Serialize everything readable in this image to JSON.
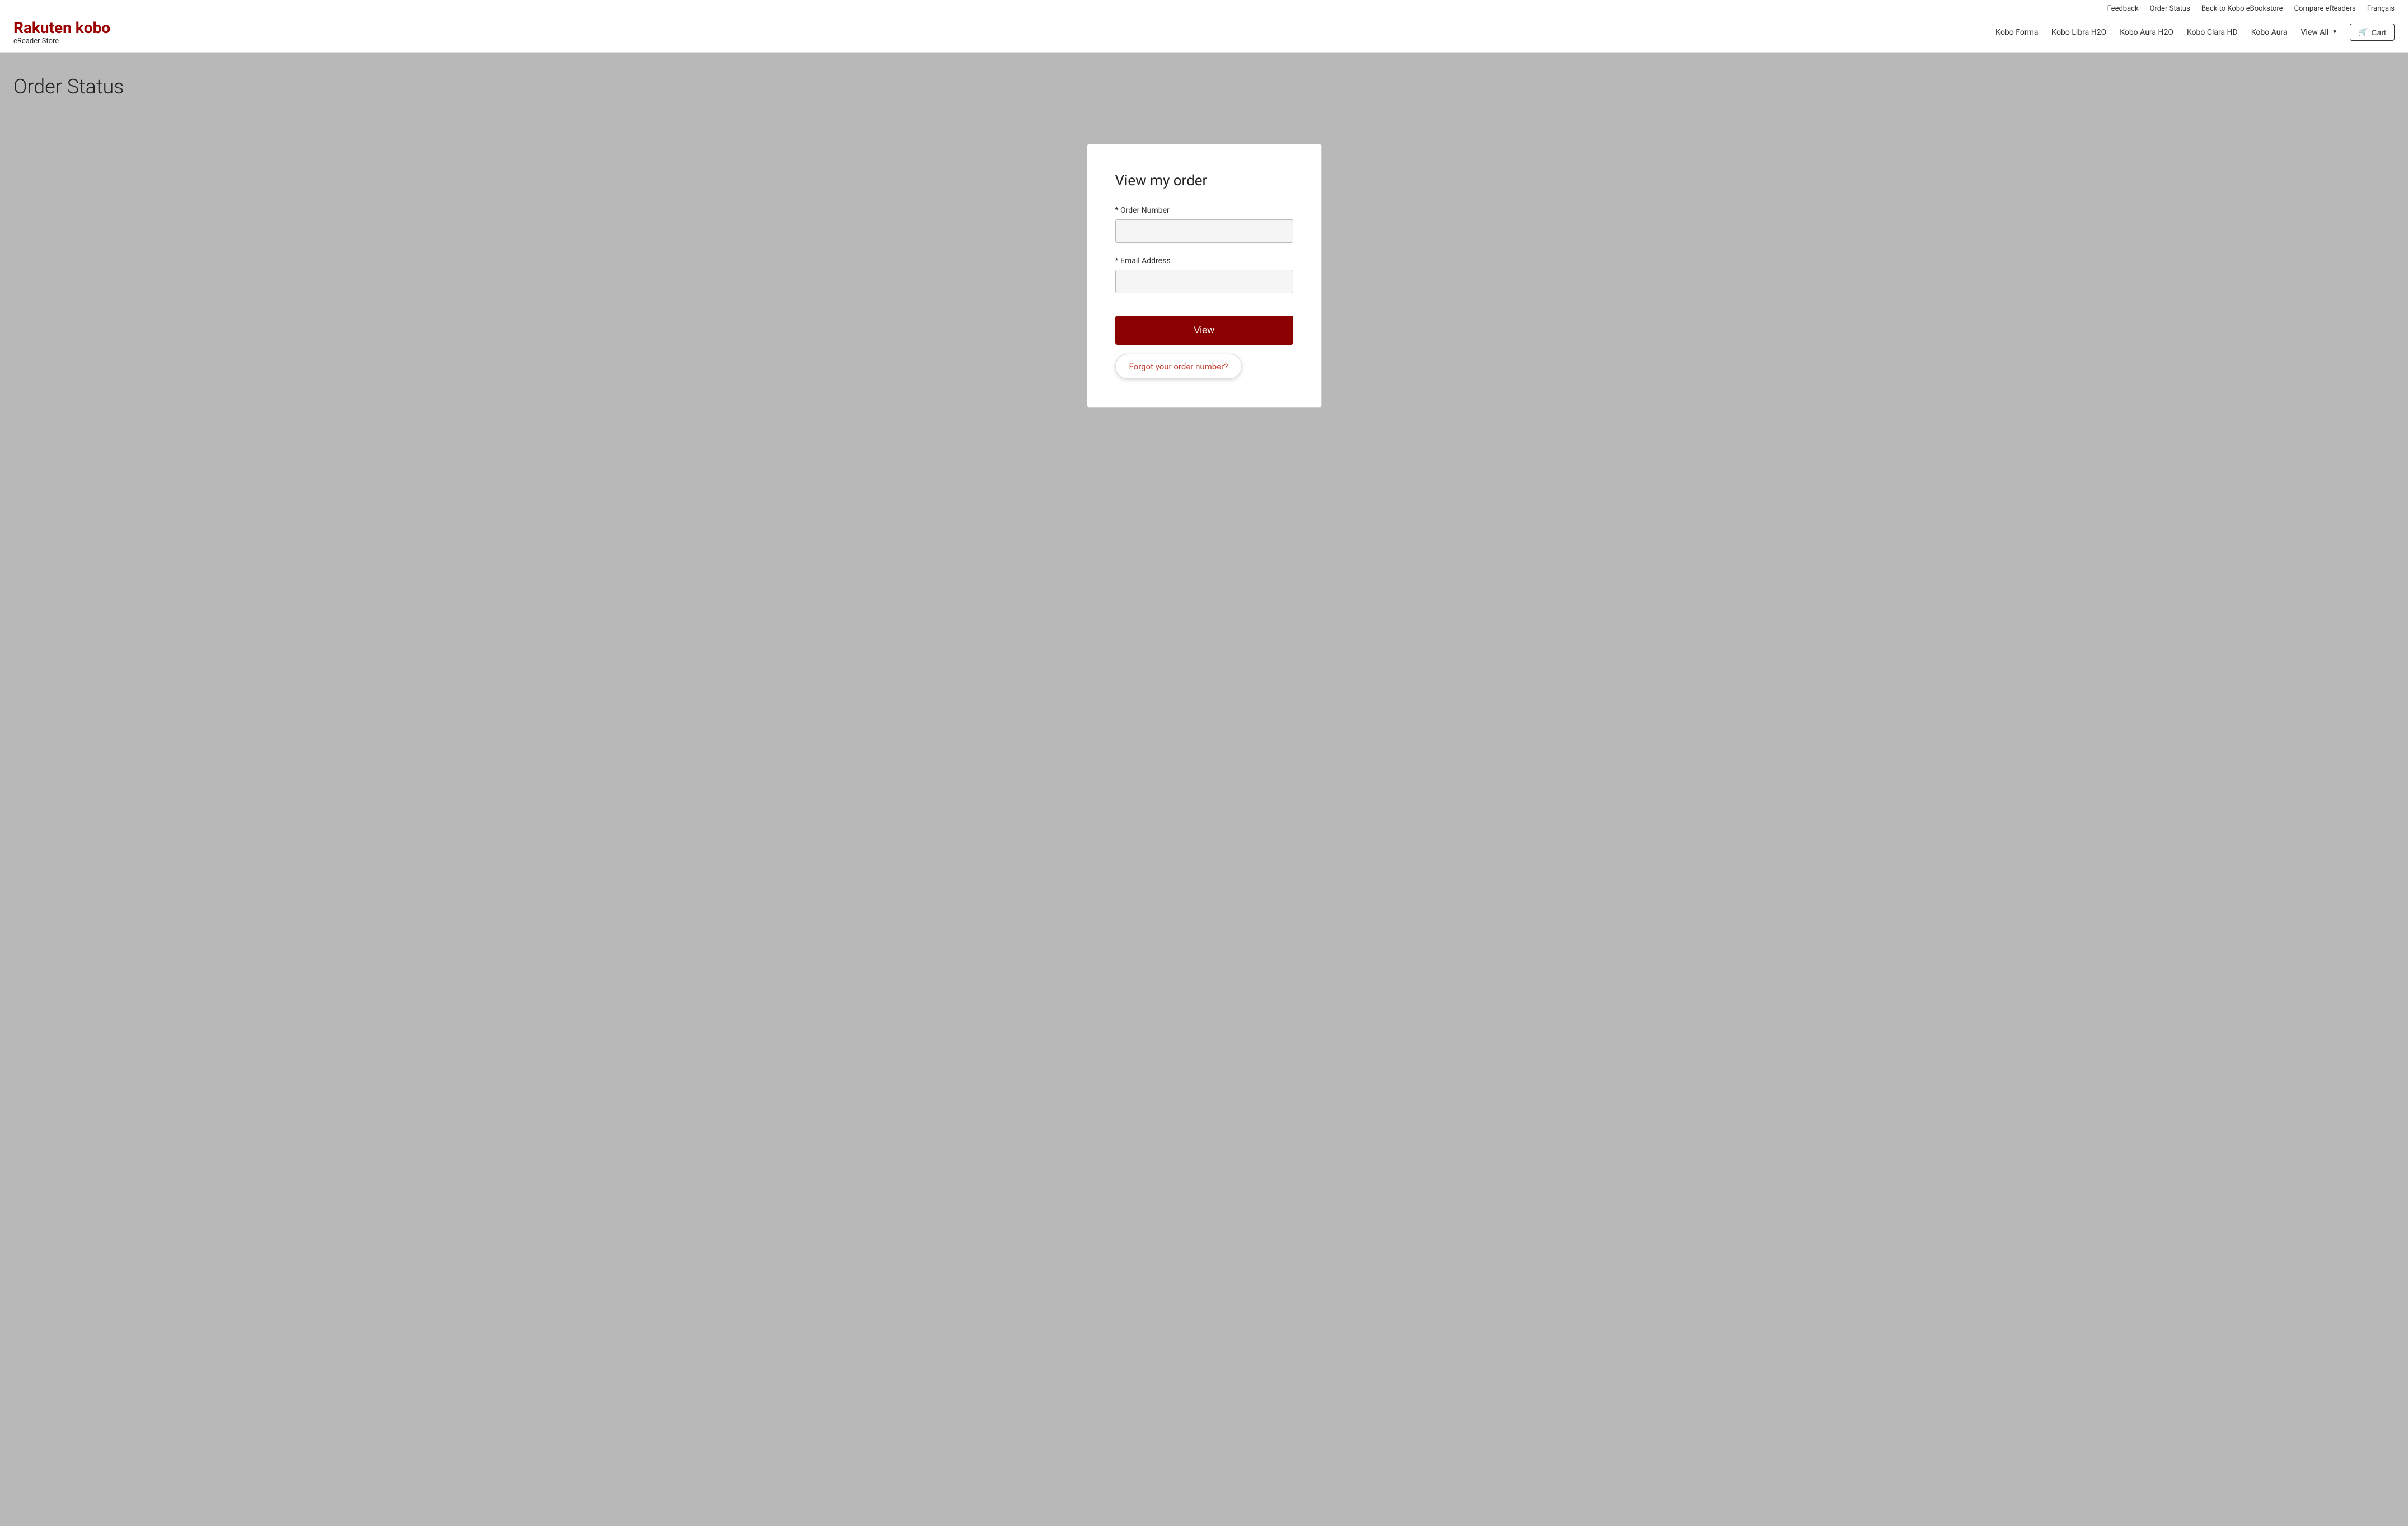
{
  "header": {
    "top_links": [
      {
        "label": "Feedback",
        "name": "feedback-link"
      },
      {
        "label": "Order Status",
        "name": "order-status-link"
      },
      {
        "label": "Back to Kobo eBookstore",
        "name": "back-to-bookstore-link"
      },
      {
        "label": "Compare eReaders",
        "name": "compare-ereaders-link"
      },
      {
        "label": "Français",
        "name": "language-link"
      }
    ],
    "logo": {
      "line1": "Rakuten kobo",
      "line2": "eReader Store"
    },
    "nav_links": [
      {
        "label": "Kobo Forma",
        "name": "nav-kobo-forma"
      },
      {
        "label": "Kobo Libra H2O",
        "name": "nav-kobo-libra"
      },
      {
        "label": "Kobo Aura H2O",
        "name": "nav-kobo-aura-h2o"
      },
      {
        "label": "Kobo Clara HD",
        "name": "nav-kobo-clara"
      },
      {
        "label": "Kobo Aura",
        "name": "nav-kobo-aura"
      },
      {
        "label": "View All",
        "name": "nav-view-all"
      }
    ],
    "cart_label": "Cart"
  },
  "page": {
    "title": "Order Status"
  },
  "form": {
    "title": "View my order",
    "order_number_label": "* Order Number",
    "order_number_placeholder": "",
    "email_label": "* Email Address",
    "email_placeholder": "",
    "view_button_label": "View",
    "forgot_link_label": "Forgot your order number?"
  }
}
